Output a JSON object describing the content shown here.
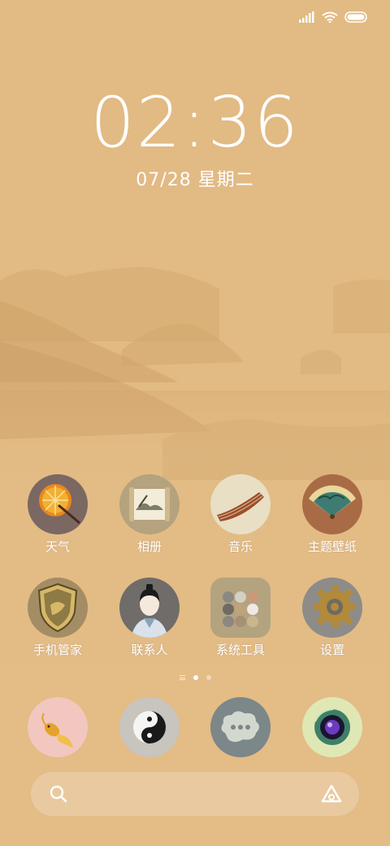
{
  "status_bar": {
    "signal_icon": "signal-icon",
    "wifi_icon": "wifi-icon",
    "battery_icon": "battery-icon"
  },
  "clock": {
    "time": "02:36",
    "date": "07/28 星期二"
  },
  "apps_row1": [
    {
      "label": "天气",
      "icon": "umbrella-icon"
    },
    {
      "label": "相册",
      "icon": "scroll-painting-icon"
    },
    {
      "label": "音乐",
      "icon": "guzheng-icon"
    },
    {
      "label": "主题壁纸",
      "icon": "folding-fan-icon"
    }
  ],
  "apps_row2": [
    {
      "label": "手机管家",
      "icon": "shield-icon"
    },
    {
      "label": "联系人",
      "icon": "scholar-icon"
    },
    {
      "label": "系统工具",
      "icon": "tools-folder-icon"
    },
    {
      "label": "设置",
      "icon": "gear-icon"
    }
  ],
  "dock": [
    {
      "icon": "goldfish-icon"
    },
    {
      "icon": "yin-yang-icon"
    },
    {
      "icon": "chat-cloud-icon"
    },
    {
      "icon": "jade-camera-icon"
    }
  ],
  "page_indicator": {
    "pages": 2,
    "active": 1
  },
  "search_bar": {
    "search_icon": "search-icon",
    "assistant_icon": "assistant-icon"
  },
  "colors": {
    "background": "#e3bb84",
    "mountain": "#c9a06b"
  }
}
